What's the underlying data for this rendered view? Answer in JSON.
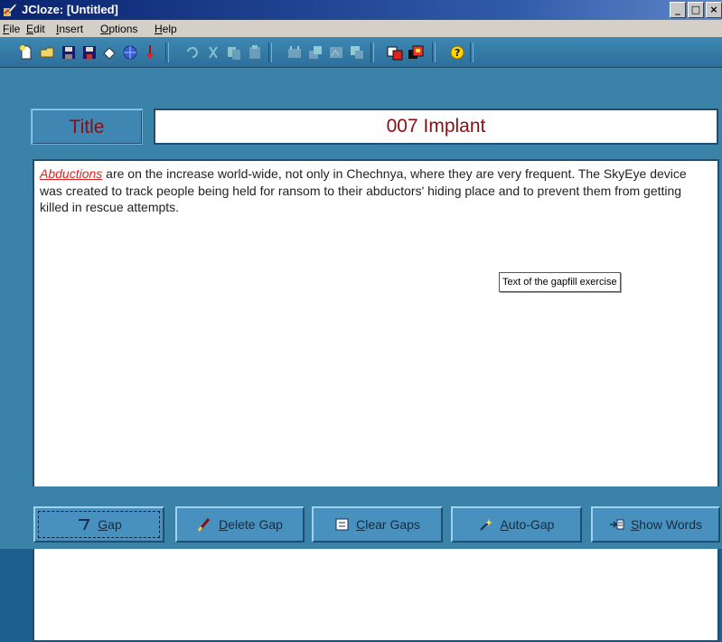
{
  "window": {
    "title": "JCloze: [Untitled]",
    "controls": [
      "_",
      "□",
      "×"
    ]
  },
  "menu": [
    "File",
    "Edit",
    "Insert",
    "Options",
    "Help"
  ],
  "toolbar": {
    "icons": [
      "new-file-icon",
      "open-folder-icon",
      "save-icon",
      "save-as-icon",
      "eraser-icon",
      "web-globe-icon",
      "red-marker-icon",
      "undo-icon",
      "cut-icon",
      "copy-icon",
      "paste-icon",
      "tool-a-icon",
      "tool-b-icon",
      "tool-c-icon",
      "tool-d-icon",
      "tool-e-icon",
      "tool-f-icon",
      "help-icon"
    ]
  },
  "title_label": "Title",
  "title_value": "007 Implant",
  "body": {
    "gap_word": "Abductions",
    "text": " are on the increase world-wide, not only in Chechnya, where they are very frequent. The SkyEye device was created to track people being held for ransom to their abductors' hiding place and  to prevent them from getting killed in rescue attempts.",
    "tooltip": "Text of the gapfill exercise"
  },
  "buttons": {
    "gap": "Gap",
    "delete_gap": "Delete Gap",
    "clear_gaps": "Clear Gaps",
    "auto_gap": "Auto-Gap",
    "show_words": "Show Words"
  },
  "colors": {
    "background": "#3b82a8",
    "title_text": "#8b0d12",
    "gap_word": "#d22222"
  }
}
